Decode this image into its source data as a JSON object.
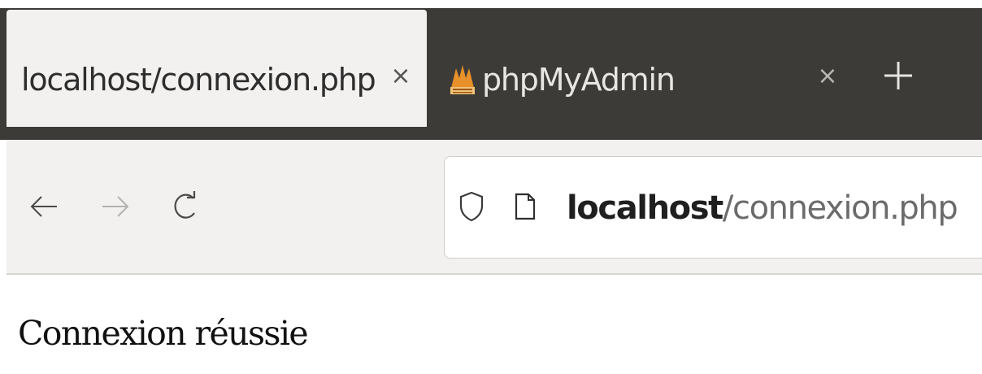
{
  "tabs": [
    {
      "title": "localhost/connexion.php",
      "close_glyph": "×",
      "active": true,
      "icon": ""
    },
    {
      "title": "phpMyAdmin",
      "close_glyph": "×",
      "active": false,
      "icon": "phpmyadmin-favicon-icon"
    }
  ],
  "new_tab_icon": "plus-icon",
  "navigation": {
    "back_icon": "arrow-left-icon",
    "forward_icon": "arrow-right-icon",
    "reload_icon": "reload-icon"
  },
  "urlbar": {
    "security_icon": "shield-icon",
    "page_icon": "page-icon",
    "host": "localhost",
    "path": "/connexion.php"
  },
  "content": {
    "message": "Connexion réussie"
  },
  "colors": {
    "tabstrip_background": "#3d3b37",
    "active_tab_background": "#f2f1f0",
    "page_background": "#ffffff",
    "favicon_orange": "#e8902a"
  }
}
